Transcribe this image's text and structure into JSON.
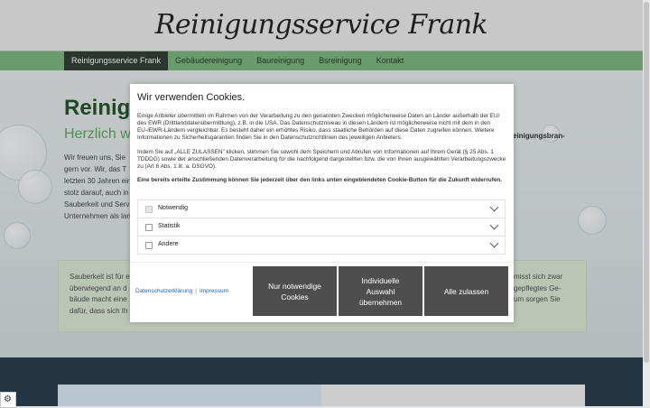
{
  "site": {
    "title": "Reinigungsservice Frank",
    "nav": [
      "Reinigungsservice Frank",
      "Gebäudereinigung",
      "Baureinigung",
      "Bsreinigung",
      "Kontakt"
    ],
    "heading_partial": "Reinig",
    "subheading_partial": "Herzlich w",
    "subheading_right": "einigungsbran-",
    "intro_lines": [
      "Wir freuen uns, Sie",
      "gern vor. Wir, das T",
      "letzten 30 Jahren eir",
      "stolz darauf, auch in",
      "Sauberkeit und Serv",
      "Unternehmen als lan"
    ],
    "box_left_lines": [
      "Sauberkeit ist für e",
      "überwiegend an d",
      "bäude macht eine",
      "dafür, dass sich Ih"
    ],
    "box_right_lines": [
      "misst sich zwar",
      "gepflegtes Ge-",
      "um sorgen Sie",
      ""
    ]
  },
  "cookie_dialog": {
    "title": "Wir verwenden Cookies.",
    "para1": "Einige Anbieter übermitteln im Rahmen von der Verarbeitung zu den genannten Zwecken möglicherweise Daten an Länder außerhalb der EU/ des EWR (Drittlanddatenübermittlung), z.B. in die USA. Das Datenschutzniveau in diesen Ländern ist möglicherweise nicht mit dem in den EU-/EWR-Ländern vergleichbar. Es besteht daher ein erhöhtes Risiko, dass staatliche Behörden auf diese Daten zugreifen können. Weitere Informationen zu Sicherheitsgarantien finden Sie in den Datenschutzrichtlinien des jeweiligen Anbieters.",
    "para2": "Indem Sie auf „ALLE ZULASSEN\" klicken, stimmen Sie sowohl dem Speichern und Abrufen von Informationen auf Ihrem Gerät (§ 25 Abs. 1 TDDDG) sowie der anschließenden Datenverarbeitung für die nachfolgend dargestellten bzw. die von Ihnen ausgewählten Verarbeitungszwecke zu (Art 6 Abs. 1 lit. a. DSGVO).",
    "para3": "Eine bereits erteilte Zustimmung können Sie jederzeit über den links unten eingeblendeten Cookie-Button für die Zukunft widerrufen.",
    "categories": [
      "Notwendig",
      "Statistik",
      "Andere"
    ],
    "link_privacy": "Datenschutzerklärung",
    "link_sep": "|",
    "link_imprint": "Impressum",
    "btn_necessary": "Nur notwendige Cookies",
    "btn_individual": "Individuelle Auswahl übernehmen",
    "btn_all": "Alle zulassen"
  }
}
